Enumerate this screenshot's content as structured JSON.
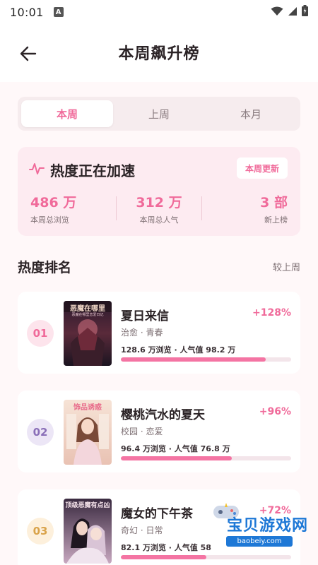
{
  "status": {
    "time": "10:01",
    "notif_letter": "A"
  },
  "header": {
    "title": "本周飙升榜"
  },
  "tabs": [
    {
      "label": "本周",
      "active": true
    },
    {
      "label": "上周",
      "active": false
    },
    {
      "label": "本月",
      "active": false
    }
  ],
  "heat_card": {
    "title": "热度正在加速",
    "update_label": "本周更新",
    "stats": [
      {
        "value": "486 万",
        "label": "本周总浏览"
      },
      {
        "value": "312 万",
        "label": "本周总人气"
      },
      {
        "value": "3 部",
        "label": "新上榜"
      }
    ]
  },
  "ranking": {
    "title": "热度排名",
    "compare_label": "较上周",
    "items": [
      {
        "rank": "01",
        "cover_text": "恶魔在哪里",
        "cover_subtext": "恶魔在哪里恋爱日记",
        "title": "夏日来信",
        "tags": "治愈 · 青春",
        "growth": "+128%",
        "stats": "128.6 万浏览 · 人气值 98.2 万",
        "progress": 0.85,
        "badge_bg": "#fde4ec",
        "badge_fg": "#f06a9a"
      },
      {
        "rank": "02",
        "cover_text": "饰品诱惑",
        "title": "樱桃汽水的夏天",
        "tags": "校园 · 恋爱",
        "growth": "+96%",
        "stats": "96.4 万浏览 · 人气值 76.8 万",
        "progress": 0.65,
        "badge_bg": "#ece6f6",
        "badge_fg": "#8a6fb8"
      },
      {
        "rank": "03",
        "cover_text": "顶级恶魔有点凶",
        "title": "魔女的下午茶",
        "tags": "奇幻 · 日常",
        "growth": "+72%",
        "stats": "82.1 万浏览 · 人气值 58",
        "progress": 0.5,
        "badge_bg": "#fdf0dc",
        "badge_fg": "#d9a34a"
      }
    ]
  },
  "watermark": {
    "text": "宝贝游戏网",
    "url": "baobeiy.com"
  },
  "colors": {
    "accent": "#f06a9a",
    "bar": "#f474a3",
    "card_bg": "#fdebf1"
  }
}
